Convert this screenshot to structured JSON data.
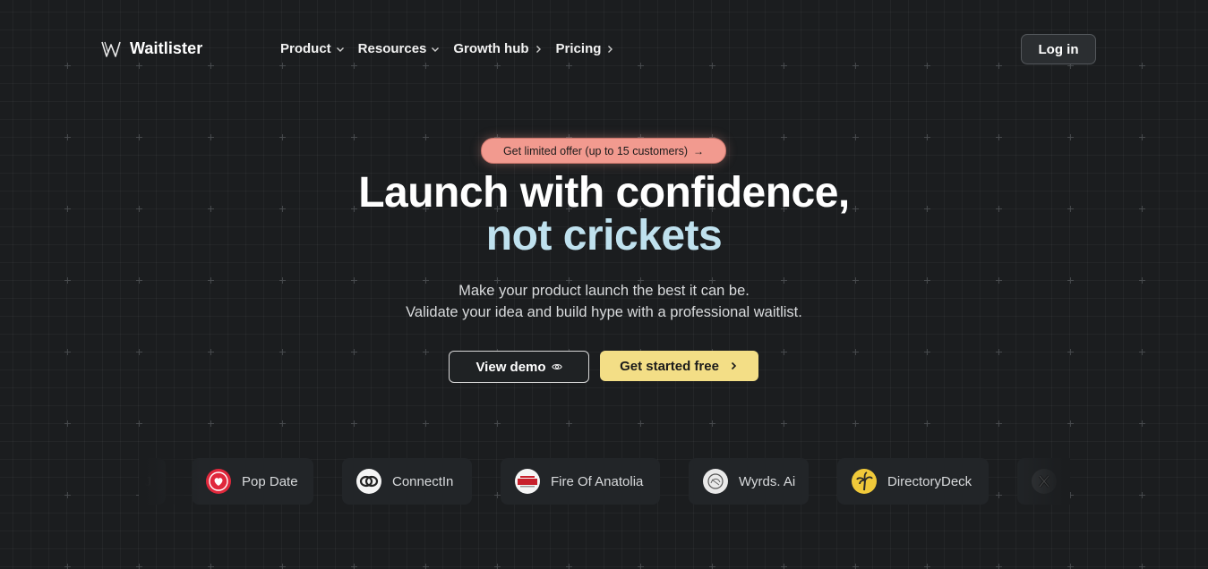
{
  "brand": {
    "name": "Waitlister",
    "logo_icon": "w-logo-icon"
  },
  "nav": {
    "items": [
      {
        "label": "Product",
        "icon": "chevron-down-icon"
      },
      {
        "label": "Resources",
        "icon": "chevron-down-icon"
      },
      {
        "label": "Growth hub",
        "icon": "chevron-right-icon"
      },
      {
        "label": "Pricing",
        "icon": "chevron-right-icon"
      }
    ],
    "login_label": "Log in"
  },
  "hero": {
    "offer_label": "Get limited offer (up to 15 customers)",
    "offer_arrow": "→",
    "headline_line1": "Launch with confidence,",
    "headline_line2": "not crickets",
    "subtext_line1": "Make your product launch the best it can be.",
    "subtext_line2": "Validate your idea and build hype with a professional waitlist.",
    "demo_label": "View demo",
    "start_label": "Get started free"
  },
  "customers": [
    {
      "name": "J",
      "icon": "partial-logo"
    },
    {
      "name": "Pop Date",
      "icon": "heart-icon"
    },
    {
      "name": "ConnectIn",
      "icon": "linked-rings-icon"
    },
    {
      "name": "Fire Of Anatolia",
      "icon": "kinay-logo-icon"
    },
    {
      "name": "Wyrds. Ai",
      "icon": "sketch-logo-icon"
    },
    {
      "name": "DirectoryDeck",
      "icon": "palm-tree-icon"
    },
    {
      "name": "",
      "icon": "x-logo-icon"
    }
  ],
  "colors": {
    "background": "#1b1d1f",
    "accent_yellow": "#f3de86",
    "accent_salmon": "#f29a8f",
    "headline_blue": "#bfe1ee"
  }
}
